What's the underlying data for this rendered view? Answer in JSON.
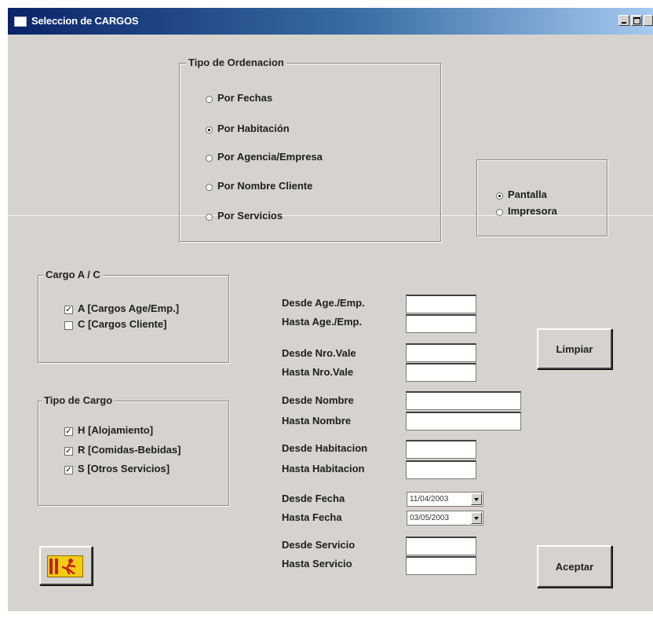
{
  "window": {
    "title": "Seleccion de CARGOS",
    "controls": [
      "_",
      "□",
      "×"
    ]
  },
  "ordenacion": {
    "legend": "Tipo de Ordenacion",
    "options": [
      {
        "label": "Por Fechas",
        "selected": false
      },
      {
        "label": "Por Habitación",
        "selected": true
      },
      {
        "label": "Por Agencia/Empresa",
        "selected": false
      },
      {
        "label": "Por Nombre Cliente",
        "selected": false
      },
      {
        "label": "Por Servicios",
        "selected": false
      }
    ]
  },
  "salida": {
    "options": [
      {
        "label": "Pantalla",
        "selected": true
      },
      {
        "label": "Impresora",
        "selected": false
      }
    ]
  },
  "cargo_ac": {
    "legend": "Cargo A / C",
    "options": [
      {
        "label": "A [Cargos Age/Emp.]",
        "checked": true
      },
      {
        "label": "C [Cargos Cliente]",
        "checked": false
      }
    ]
  },
  "tipo_cargo": {
    "legend": "Tipo de Cargo",
    "options": [
      {
        "label": "H [Alojamiento]",
        "checked": true
      },
      {
        "label": "R [Comidas-Bebidas]",
        "checked": true
      },
      {
        "label": "S [Otros Servicios]",
        "checked": true
      }
    ]
  },
  "filters": {
    "desde_age": {
      "label": "Desde Age./Emp.",
      "value": ""
    },
    "hasta_age": {
      "label": "Hasta Age./Emp.",
      "value": ""
    },
    "desde_vale": {
      "label": "Desde Nro.Vale",
      "value": ""
    },
    "hasta_vale": {
      "label": "Hasta Nro.Vale",
      "value": ""
    },
    "desde_nombre": {
      "label": "Desde Nombre",
      "value": ""
    },
    "hasta_nombre": {
      "label": "Hasta Nombre",
      "value": ""
    },
    "desde_hab": {
      "label": "Desde Habitacion",
      "value": ""
    },
    "hasta_hab": {
      "label": "Hasta Habitacion",
      "value": ""
    },
    "desde_fecha": {
      "label": "Desde Fecha",
      "value": "11/04/2003"
    },
    "hasta_fecha": {
      "label": "Hasta Fecha",
      "value": "03/05/2003"
    },
    "desde_servicio": {
      "label": "Desde Servicio",
      "value": ""
    },
    "hasta_servicio": {
      "label": "Hasta Servicio",
      "value": ""
    }
  },
  "buttons": {
    "limpiar": "Limpiar",
    "aceptar": "Aceptar"
  }
}
